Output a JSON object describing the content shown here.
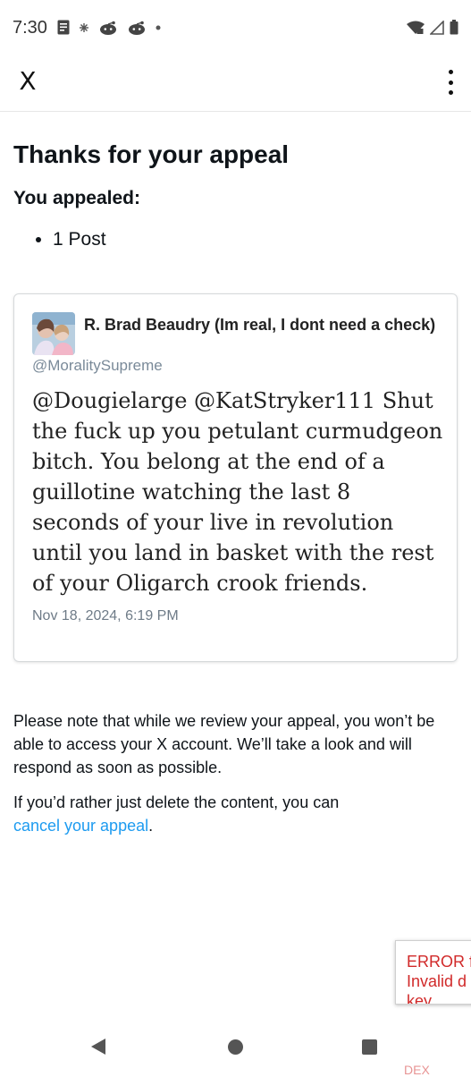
{
  "status_bar": {
    "time": "7:30",
    "notification_icons": [
      "doc-icon",
      "snowflake-icon",
      "reddit-icon",
      "reddit-icon",
      "dot-icon"
    ],
    "right_icons": [
      "wifi-icon",
      "signal-icon",
      "battery-icon"
    ]
  },
  "header": {
    "close_label": "X",
    "more_icon": "more-vertical-icon"
  },
  "main": {
    "title": "Thanks for your appeal",
    "appealed_label": "You appealed:",
    "appealed_items": [
      "1 Post"
    ]
  },
  "post": {
    "author_name": "R. Brad Beaudry (Im real, I dont need a check)",
    "handle": "@MoralitySupreme",
    "text": "@Dougielarge @KatStryker111 Shut the fuck up you petulant curmudgeon bitch. You belong at the end of a guillotine watching the last 8 seconds of your live in revolution until you land in basket with the rest of your Oligarch crook friends.",
    "timestamp": "Nov 18, 2024, 6:19 PM"
  },
  "notice": {
    "paragraph1": "Please note that while we review your appeal, you won’t be able to access your X account. We’ll take a look and will respond as soon as possible.",
    "paragraph2_prefix": "If you’d rather just delete the content, you can",
    "cancel_link": "cancel your appeal",
    "paragraph2_suffix": "."
  },
  "error_overlay": {
    "line1": "ERROR f",
    "line2": "Invalid d",
    "line3": "key",
    "ghost": "DEX"
  },
  "colors": {
    "link": "#1d9bf0",
    "error": "#d12a2a",
    "text": "#0f1419",
    "muted": "#7a8a99"
  },
  "nav_bar": {
    "icons": [
      "back-icon",
      "home-icon",
      "recents-icon"
    ]
  }
}
